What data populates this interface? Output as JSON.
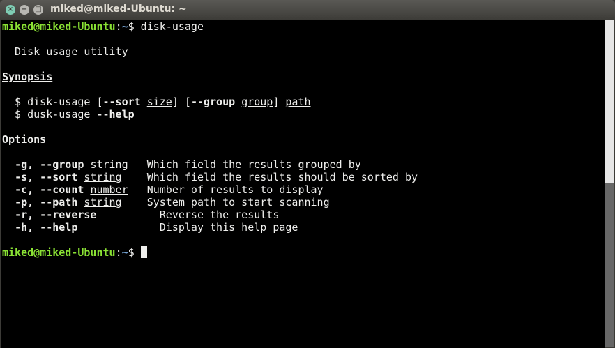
{
  "window": {
    "title": "miked@miked-Ubuntu: ~",
    "close": "×",
    "minimize": "−",
    "maximize": "□"
  },
  "colors": {
    "prompt_user": "#8ae234",
    "prompt_path": "#729fcf",
    "background": "#000000",
    "text": "#eeeeec"
  },
  "terminal": {
    "lines": [
      [
        {
          "t": "miked@miked-Ubuntu",
          "c": "green"
        },
        {
          "t": ":"
        },
        {
          "t": "~",
          "c": "blue"
        },
        {
          "t": "$ disk-usage"
        }
      ],
      [],
      [
        {
          "t": "  Disk usage utility"
        }
      ],
      [],
      [
        {
          "t": "Synopsis",
          "c": "b u"
        }
      ],
      [],
      [
        {
          "t": "  $ disk-usage ["
        },
        {
          "t": "--sort",
          "c": "b"
        },
        {
          "t": " "
        },
        {
          "t": "size",
          "c": "u"
        },
        {
          "t": "] ["
        },
        {
          "t": "--group",
          "c": "b"
        },
        {
          "t": " "
        },
        {
          "t": "group",
          "c": "u"
        },
        {
          "t": "] "
        },
        {
          "t": "path",
          "c": "u"
        }
      ],
      [
        {
          "t": "  $ dusk-usage "
        },
        {
          "t": "--help",
          "c": "b"
        }
      ],
      [],
      [
        {
          "t": "Options",
          "c": "b u"
        }
      ],
      [],
      [
        {
          "t": "  "
        },
        {
          "t": "-g, --group",
          "c": "b"
        },
        {
          "t": " "
        },
        {
          "t": "string",
          "c": "u"
        },
        {
          "t": "   Which field the results grouped by"
        }
      ],
      [
        {
          "t": "  "
        },
        {
          "t": "-s, --sort",
          "c": "b"
        },
        {
          "t": " "
        },
        {
          "t": "string",
          "c": "u"
        },
        {
          "t": "    Which field the results should be sorted by"
        }
      ],
      [
        {
          "t": "  "
        },
        {
          "t": "-c, --count",
          "c": "b"
        },
        {
          "t": " "
        },
        {
          "t": "number",
          "c": "u"
        },
        {
          "t": "   Number of results to display"
        }
      ],
      [
        {
          "t": "  "
        },
        {
          "t": "-p, --path",
          "c": "b"
        },
        {
          "t": " "
        },
        {
          "t": "string",
          "c": "u"
        },
        {
          "t": "    System path to start scanning"
        }
      ],
      [
        {
          "t": "  "
        },
        {
          "t": "-r, --reverse",
          "c": "b"
        },
        {
          "t": "          Reverse the results"
        }
      ],
      [
        {
          "t": "  "
        },
        {
          "t": "-h, --help",
          "c": "b"
        },
        {
          "t": "             Display this help page"
        }
      ],
      [],
      [
        {
          "t": "miked@miked-Ubuntu",
          "c": "green"
        },
        {
          "t": ":"
        },
        {
          "t": "~",
          "c": "blue"
        },
        {
          "t": "$ "
        },
        {
          "cursor": true
        }
      ]
    ]
  },
  "scrollbar": {
    "position_fraction": 1.0,
    "visible_fraction": 0.5
  }
}
